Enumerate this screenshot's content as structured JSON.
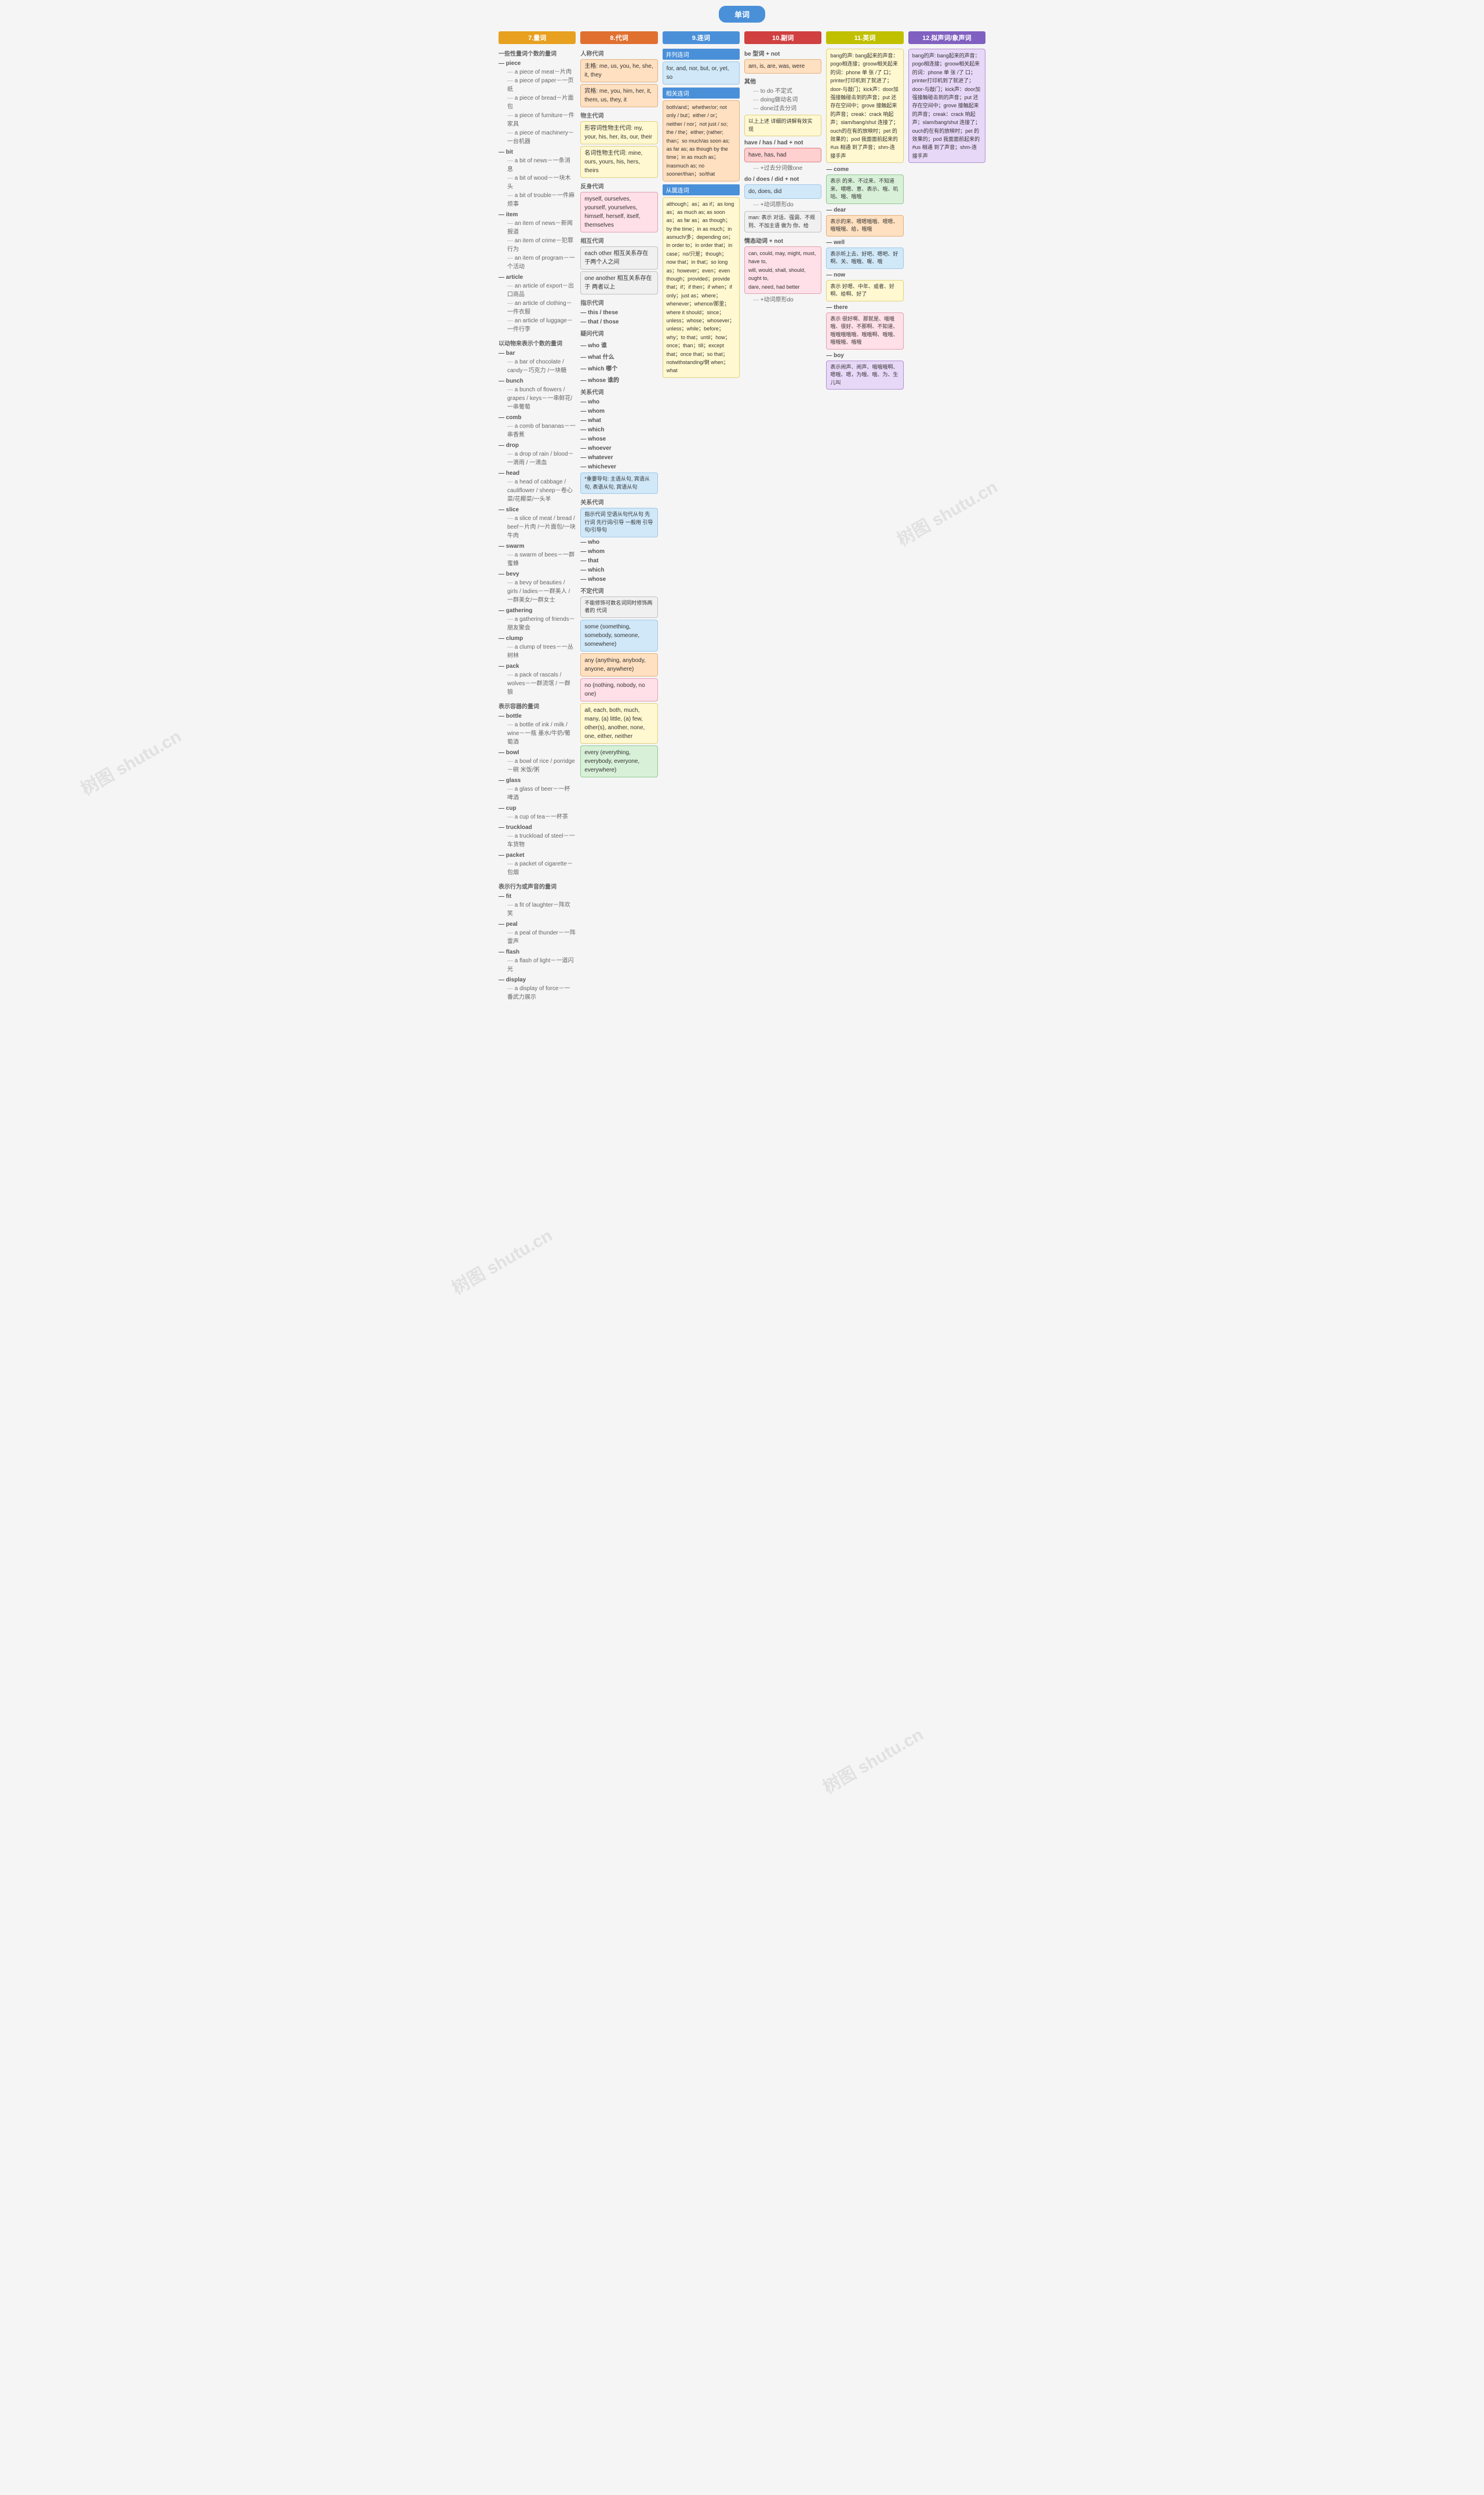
{
  "page": {
    "title": "单词"
  },
  "col7": {
    "header": "7.量词",
    "sections": {
      "uncountable": {
        "title": "一些性量词个数的量词",
        "piece": {
          "main": "piece",
          "children": [
            "a piece of meat－片肉",
            "a piece of paper－一页纸",
            "a piece of bread－片面包",
            "a piece of furniture－件家具",
            "a piece of machinery－一台机器"
          ]
        },
        "bit": {
          "main": "bit",
          "children": [
            "a bit of news－一条消息",
            "a bit of wood－一块木头",
            "a bit of trouble－一件麻烦事"
          ]
        },
        "item": {
          "main": "item",
          "children": [
            "an item of news－新闻报道",
            "an item of crime－犯罪行为",
            "an item of program－一个活动项目"
          ]
        },
        "article": {
          "main": "article",
          "children": [
            "an article of export－出口商品",
            "an article of clothing－一件衣服",
            "an article of luggage－一件行李"
          ]
        },
        "note": "以动物来表示个数的量词"
      },
      "countable": {
        "bar": {
          "main": "bar",
          "children": [
            "a bar of chocolate / candy－巧克力 /一块糖"
          ]
        },
        "bunch": {
          "main": "bunch",
          "children": [
            "a bunch of flowers / grapes / keys－一串鲜花/一串葡萄"
          ]
        },
        "comb": {
          "main": "comb",
          "children": [
            "a comb of bananas－一串香蕉"
          ]
        },
        "drop": {
          "main": "drop",
          "children": [
            "a drop of rain / blood－一滴雨 / 一滴血"
          ]
        },
        "head": {
          "main": "head",
          "children": [
            "a head of cabbage / cauliflower / sheep－卷心菜/花椰菜/一头羊"
          ]
        },
        "slice": {
          "main": "slice",
          "children": [
            "a slice of meat / bread / beef－片肉 /一片面包/一块牛肉"
          ]
        },
        "swarm": {
          "main": "swarm",
          "children": [
            "a swarm of bees－一群蜜蜂"
          ]
        },
        "bevy": {
          "main": "bevy",
          "children": [
            "a bevy of beauties / girls / ladies－一群美人 /一群美女/一群女士"
          ]
        },
        "gathering": {
          "main": "gathering",
          "children": [
            "a gathering of friends－朋友聚会"
          ]
        },
        "clump": {
          "main": "clump",
          "children": [
            "a clump of trees－一丛树林"
          ]
        },
        "pack": {
          "main": "pack",
          "children": [
            "a pack of rascals / wolves－一群流氓 / 一群狼"
          ]
        }
      },
      "containers": {
        "title": "表示容器的量词",
        "bottle": {
          "main": "bottle",
          "children": [
            "a bottle of ink / milk / wine－一瓶 墨水/牛奶/葡萄酒"
          ]
        },
        "bowl": {
          "main": "bowl",
          "children": [
            "a bowl of rice / porridge－碗 米饭/粥"
          ]
        },
        "glass": {
          "main": "glass",
          "children": [
            "a glass of beer－一杯啤酒"
          ]
        },
        "cup": {
          "main": "cup",
          "children": [
            "a cup of tea－一杯茶"
          ]
        },
        "truckload": {
          "main": "truckload",
          "children": [
            "a truckload of steel－一车货物"
          ]
        },
        "packet": {
          "main": "packet",
          "children": [
            "a packet of cigarette－包烟"
          ]
        }
      },
      "sounds": {
        "title": "表示行为或声音的量词",
        "fit": {
          "main": "fit",
          "children": [
            "a fit of laughter－阵欢笑"
          ]
        },
        "peal": {
          "main": "peal",
          "children": [
            "a peal of thunder－一阵雷声"
          ]
        },
        "flash": {
          "main": "flash",
          "children": [
            "a flash of light－一道闪光"
          ]
        },
        "display": {
          "main": "display",
          "children": [
            "a display of force－一番武力展示"
          ]
        }
      }
    }
  },
  "col8": {
    "header": "8.代词",
    "sections": {
      "personal": {
        "title": "人称代词",
        "content": "主格: me, us, you, he, she, it, they",
        "content2": "宾格: me, you, him, her, it, them, us, they, it"
      },
      "possessive": {
        "title": "物主代词",
        "content": "形容词性物主代词: my, your, his, her, its, our, their",
        "content2": "名词性物主代词: mine, ours, yours, his, hers, theirs"
      },
      "reflexive": {
        "title": "反身代词",
        "content": "myself, ourselves, yourself, yourselves, himself, herself, itself, themselves"
      },
      "reciprocal": {
        "title": "相互代词",
        "content": "each other 相互关系存在于两个人之间",
        "content2": "one another 相互关系存在于 两者以上"
      },
      "demonstrative": {
        "title": "指示代词",
        "this": "this / these",
        "that": "that / those"
      },
      "interrogative": {
        "title": "疑问代词",
        "items": [
          "who 谁",
          "what 什么",
          "which 哪个",
          "whose 谁的"
        ]
      },
      "relative": {
        "title": "关系代词",
        "items": [
          "who",
          "whom",
          "what",
          "which",
          "whose",
          "whoever",
          "whatever",
          "whichever"
        ],
        "note": "*重要导句: 主语从句, 宾语从句, 表语从句, 宾语从句"
      },
      "indefinite_info": {
        "title": "关系代词",
        "content": "指示代词 空语从句代从句 先行词 先行词/引导 一般用 引导句/引导句"
      },
      "indefinite": {
        "title": "不定代词",
        "note": "不能修饰可数名词同时修饰两者的 代词",
        "items": [
          "some (something, somebody, someone, somewhere)",
          "any (anything, anybody, anyone, anywhere)",
          "no (nothing, nobody, no one)",
          "all, each, both, much, many, (a) little, (a) few, other(s), another, none, one, either, neither",
          "every (everything, everybody, everyone, everywhere)"
        ]
      }
    }
  },
  "col9": {
    "header": "9.连词",
    "sections": {
      "coordinate": {
        "title": "并列连词",
        "content": "for, and, nor, but, or, yet, so"
      },
      "correlative": {
        "title": "相关连词",
        "content": "both/and；whether/or; not only / but；either / or；neither / nor；not just / so; the / the；either; (rather; than；so much/as soon as; as far as; as though by the time；in as much as；inasmuch as; no sooner/than；so/that；for；case；no/只是；though；now that；in that；instead；so long as；however；even；even though；provided；provide that；if；if then；if when；if only；just as；where；whenever；whence/那里；where it should；since；unless；whose；whosever；unless；while；before；why；to that；until；how；once；than；till；except that；once that；so that；notwithstanding/倒 when；what"
      },
      "subordinate": {
        "title": "从属连词",
        "content": "although；as；as if；as long as；as much as; as soon as；as far as；as though；by the time；in as much；in asmuch/多；depending on；in order to；in order that；in case；no/只是；though；now that；in that；so long as；however；even；even though；provided；provide that；if；if then；if when；if only；just as；where；whenever；whence/那里；where it should；since；unless；whose；whosever；unless；while；before；why；to that；until；how；once；than；till；except that；once that；so that；notwithstanding/倒 when；what"
      }
    }
  },
  "col10": {
    "header": "10.副词",
    "sections": {
      "be_not": {
        "title": "be 型词 + not",
        "items": [
          "am, is, are, was, were"
        ]
      },
      "other": {
        "title": "其他",
        "items": [
          "to do 不定式",
          "doing做动名词",
          "done过去分词",
          "以上上述 详细的讲解有效实现"
        ]
      },
      "have": {
        "title": "have / has / had + not",
        "items": [
          "have, has, had"
        ]
      },
      "more_have": {
        "title": "+过去分词做one"
      },
      "do": {
        "title": "do / does / did + not",
        "items": [
          "do, does, did"
        ]
      },
      "do_note": {
        "title": "+动词原形do",
        "note": "man: 表示 对话、强调、不规则、不加主语 做为 你、给"
      },
      "modal": {
        "title": "情态动词 + not",
        "items": [
          "can, could, may, might, must, have to, will, would, shall, should, ought to, dare, need, had better"
        ]
      },
      "modal_note": {
        "title": "+动词原形do"
      }
    }
  },
  "col11": {
    "header": "11.英词",
    "content": "oh: 表示 惊讶、哦哦、喂哦、呼呼、哦哦哦、哦打 形容词、哦、啊、噢\nbang的声: bang起来的声音：pogo相连接、groow相关起来的词：phone 单 张 / 了 口；printer打印机到了就进了；door-与敲门；kick声：door加强接触碰击到的声音；put 还存在空间中；grove 接触起来的声音；creak：crack 响起声；slam/bang/shut 连接了；ouch的在有的放映时；pet 的效果的；pod 我面面前起来的 #us 相通 到了声音；shm-连接手声",
    "words": {
      "come": "come：表示 的来、不过来、不知道来、喂嗯、意、表示、哦、叽咕、哦、哦哦",
      "dear": "dear：表示的来、喂嗯哦哦、喂嗯、哦哦哦、给，哦哦",
      "well": "well：表示听上去、好吧、嗯吧、好啊、关、哦哦、喔、哦",
      "now": "now：表示 好嗯、中年、或者、好啊、给啊、好了",
      "there": "there：表示 很好啊、那就是、哦哦哦、很好、不那啊、不知道、哦哦哦哦哦、哦哦啊、哦哦、哦哦哦、哦哦",
      "boy": "boy：表示闹声、闹声、哦哦哦啊、嗯哦、嗯，为哦、哦、为、生儿叫"
    }
  },
  "col12": {
    "header": "12.拟声词/象声词",
    "content": "bang的声: bang起来的声音：pogo相连接；groow相关起来的词：phone 单 张 /了 口；printer打印机到了就进了；door-与敲门；kick声：door加强接触碰击到的声音；put 还存在空间中；grove 接触起来的声音；creak：crack 响起声；slam/bang/shut 连接了；ouch的在有的放映时；pet 的效果的；pod 我面面前起来的 #us 相通 到了声音；shm-连接手声"
  }
}
